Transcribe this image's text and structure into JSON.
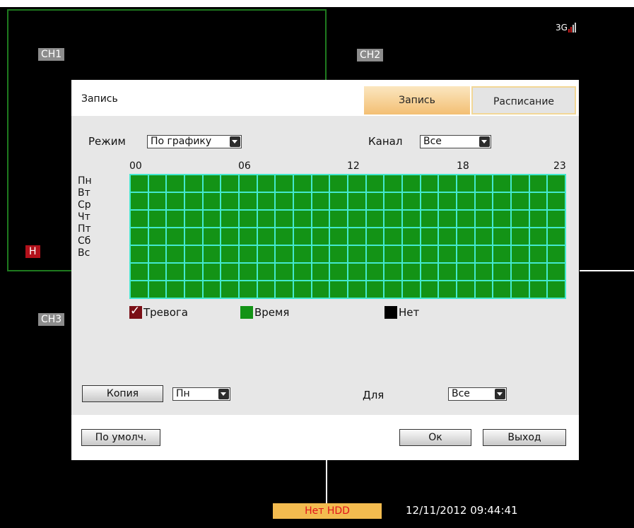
{
  "channels": [
    "CH1",
    "CH2",
    "CH3"
  ],
  "h_badge": "H",
  "signal": {
    "label": "3G"
  },
  "status": {
    "hdd": "Нет HDD",
    "datetime": "12/11/2012 09:44:41"
  },
  "dialog": {
    "title": "Запись",
    "tabs": [
      "Запись",
      "Расписание"
    ],
    "mode_label": "Режим",
    "mode_value": "По графику",
    "channel_label": "Канал",
    "channel_value": "Все",
    "hour_labels": [
      "00",
      "06",
      "12",
      "18",
      "23"
    ],
    "days": [
      "Пн",
      "Вт",
      "Ср",
      "Чт",
      "Пт",
      "Сб",
      "Вс"
    ],
    "schedule": {
      "hours": 24,
      "fill": "Время",
      "colors": {
        "grid_bg": "#44e8cf",
        "time": "#139316",
        "alarm": "#7a0f16",
        "none": "#000000"
      }
    },
    "legend": {
      "alarm": "Тревога",
      "time": "Время",
      "none": "Нет"
    },
    "copy_button": "Копия",
    "copy_from": "Пн",
    "for_label": "Для",
    "for_value": "Все",
    "default_button": "По умолч.",
    "ok_button": "Ок",
    "exit_button": "Выход"
  }
}
